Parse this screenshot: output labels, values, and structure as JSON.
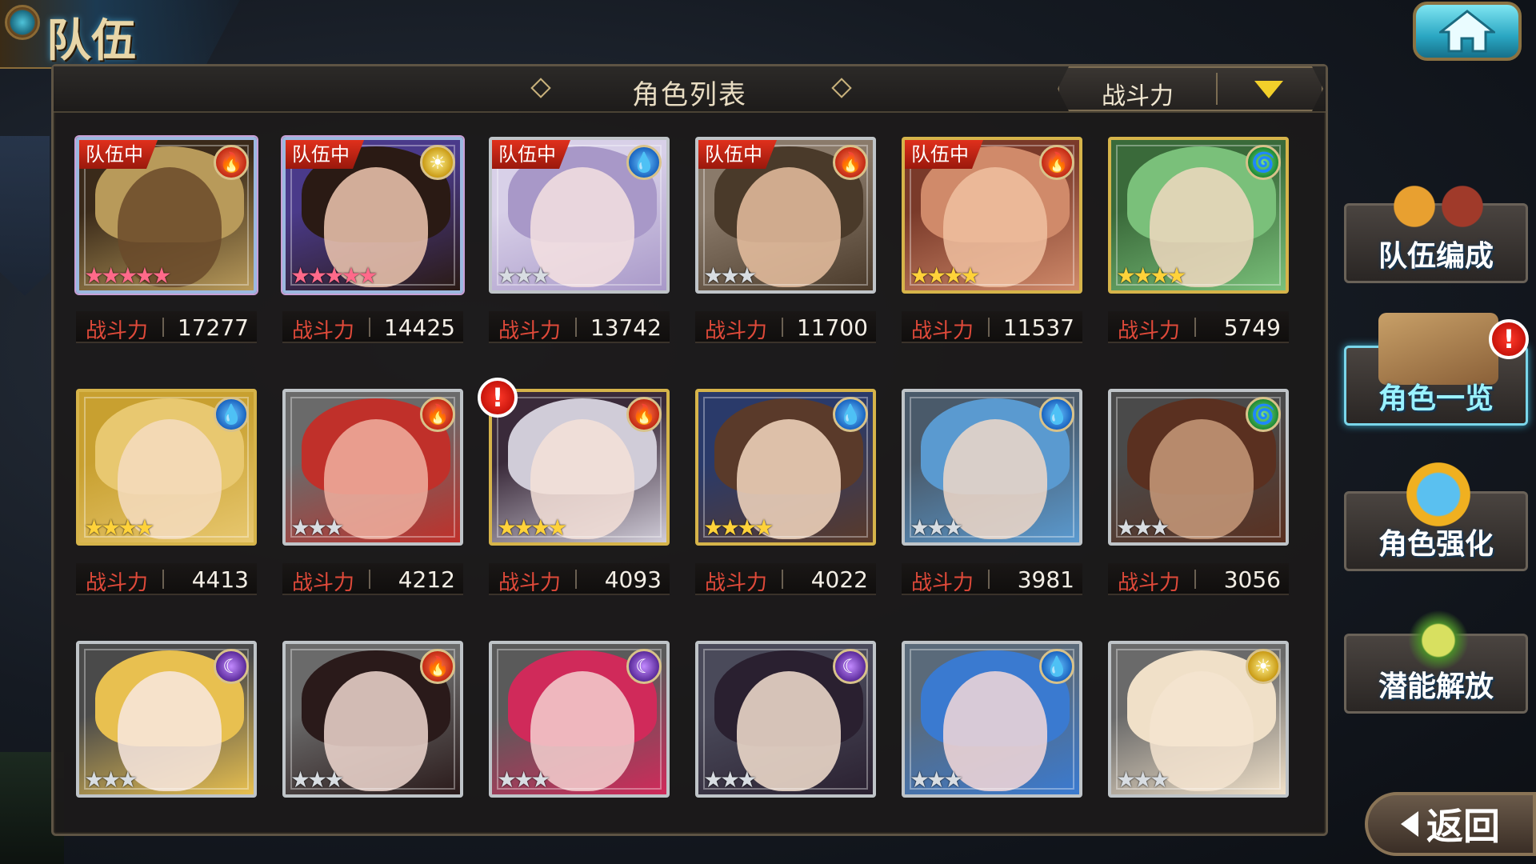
{
  "screen_title": "队伍",
  "header": {
    "title": "角色列表",
    "sort_label": "战斗力"
  },
  "power_label": "战斗力",
  "in_team_label": "队伍中",
  "characters": [
    {
      "element": "fire",
      "frame": "rainbow",
      "stars": 5,
      "in_team": true,
      "power": "17277",
      "colors": [
        "#3a2a1a",
        "#b89a5a",
        "#6a4a2a"
      ]
    },
    {
      "element": "light",
      "frame": "rainbow",
      "stars": 5,
      "in_team": true,
      "power": "14425",
      "colors": [
        "#4a3a8a",
        "#2a1a14",
        "#f0c8b0"
      ]
    },
    {
      "element": "water",
      "frame": "silver",
      "stars": 3,
      "in_team": true,
      "power": "13742",
      "colors": [
        "#d8d0e8",
        "#a898c8",
        "#f4e0e0"
      ]
    },
    {
      "element": "fire",
      "frame": "silver",
      "stars": 3,
      "in_team": true,
      "power": "11700",
      "colors": [
        "#8a7a6a",
        "#4a3a2a",
        "#e8c0a0"
      ]
    },
    {
      "element": "fire",
      "frame": "gold",
      "stars": 4,
      "in_team": true,
      "power": "11537",
      "colors": [
        "#7a3a2a",
        "#d08a6a",
        "#f0c0a0"
      ]
    },
    {
      "element": "wind",
      "frame": "gold",
      "stars": 4,
      "in_team": false,
      "power": "5749",
      "colors": [
        "#3a6a3a",
        "#7ac07a",
        "#f0d8c0"
      ]
    },
    {
      "element": "water",
      "frame": "gold",
      "stars": 4,
      "in_team": false,
      "power": "4413",
      "colors": [
        "#c8a030",
        "#e8c870",
        "#f4dcc0"
      ]
    },
    {
      "element": "fire",
      "frame": "silver",
      "stars": 3,
      "in_team": false,
      "power": "4212",
      "colors": [
        "#6a6a6a",
        "#c0302a",
        "#f0b0a0"
      ]
    },
    {
      "element": "fire",
      "frame": "gold",
      "stars": 4,
      "in_team": false,
      "power": "4093",
      "colors": [
        "#3a2a3a",
        "#d0ccd8",
        "#f4e0d8"
      ],
      "alert": true
    },
    {
      "element": "water",
      "frame": "gold",
      "stars": 4,
      "in_team": false,
      "power": "4022",
      "colors": [
        "#2a3a6a",
        "#5a3a2a",
        "#f4d8c0"
      ]
    },
    {
      "element": "water",
      "frame": "silver",
      "stars": 3,
      "in_team": false,
      "power": "3981",
      "colors": [
        "#4a5a6a",
        "#5a9ad0",
        "#f0d8c8"
      ]
    },
    {
      "element": "wind",
      "frame": "silver",
      "stars": 3,
      "in_team": false,
      "power": "3056",
      "colors": [
        "#4a4a4a",
        "#5a3020",
        "#c89a7a"
      ]
    },
    {
      "element": "dark",
      "frame": "silver",
      "stars": 3,
      "in_team": false,
      "power": "",
      "colors": [
        "#4a4a4a",
        "#e8c050",
        "#f8e8e0"
      ]
    },
    {
      "element": "fire",
      "frame": "silver",
      "stars": 3,
      "in_team": false,
      "power": "",
      "colors": [
        "#6a6a6a",
        "#2a1a1a",
        "#f0d8d0"
      ]
    },
    {
      "element": "dark",
      "frame": "silver",
      "stars": 3,
      "in_team": false,
      "power": "",
      "colors": [
        "#5a5a5a",
        "#d02a5a",
        "#f4d0d0"
      ]
    },
    {
      "element": "dark",
      "frame": "silver",
      "stars": 3,
      "in_team": false,
      "power": "",
      "colors": [
        "#4a4a5a",
        "#2a2030",
        "#f4e0d0"
      ]
    },
    {
      "element": "water",
      "frame": "silver",
      "stars": 3,
      "in_team": false,
      "power": "",
      "colors": [
        "#5a6a7a",
        "#3a7ad0",
        "#f4d8d8"
      ]
    },
    {
      "element": "light",
      "frame": "silver",
      "stars": 3,
      "in_team": false,
      "power": "",
      "colors": [
        "#6a6a6a",
        "#f0e0c8",
        "#f4e4d0"
      ]
    }
  ],
  "side_menu": [
    {
      "label": "队伍编成",
      "active": false,
      "alert": false
    },
    {
      "label": "角色一览",
      "active": true,
      "alert": true
    },
    {
      "label": "角色强化",
      "active": false,
      "alert": false
    },
    {
      "label": "潜能解放",
      "active": false,
      "alert": false
    }
  ],
  "back_label": "返回",
  "alert_symbol": "!",
  "element_glyphs": {
    "fire": "🔥",
    "water": "💧",
    "wind": "🌀",
    "light": "☀",
    "dark": "☾"
  },
  "star_glyph": "★"
}
